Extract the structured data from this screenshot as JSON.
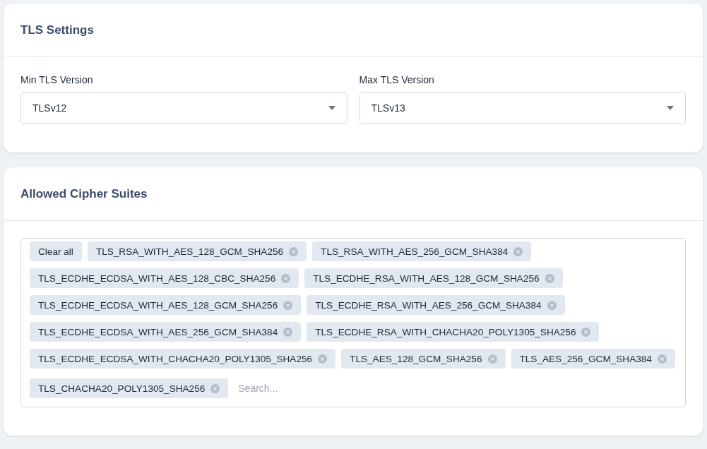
{
  "tls_settings": {
    "title": "TLS Settings",
    "fields": [
      {
        "label": "Min TLS Version",
        "value": "TLSv12"
      },
      {
        "label": "Max TLS Version",
        "value": "TLSv13"
      }
    ]
  },
  "cipher_suites": {
    "title": "Allowed Cipher Suites",
    "clear_label": "Clear all",
    "placeholder": "Search...",
    "tags": [
      "TLS_RSA_WITH_AES_128_GCM_SHA256",
      "TLS_RSA_WITH_AES_256_GCM_SHA384",
      "TLS_ECDHE_ECDSA_WITH_AES_128_CBC_SHA256",
      "TLS_ECDHE_RSA_WITH_AES_128_GCM_SHA256",
      "TLS_ECDHE_ECDSA_WITH_AES_128_GCM_SHA256",
      "TLS_ECDHE_RSA_WITH_AES_256_GCM_SHA384",
      "TLS_ECDHE_ECDSA_WITH_AES_256_GCM_SHA384",
      "TLS_ECDHE_RSA_WITH_CHACHA20_POLY1305_SHA256",
      "TLS_ECDHE_ECDSA_WITH_CHACHA20_POLY1305_SHA256",
      "TLS_AES_128_GCM_SHA256",
      "TLS_AES_256_GCM_SHA384",
      "TLS_CHACHA20_POLY1305_SHA256"
    ]
  }
}
